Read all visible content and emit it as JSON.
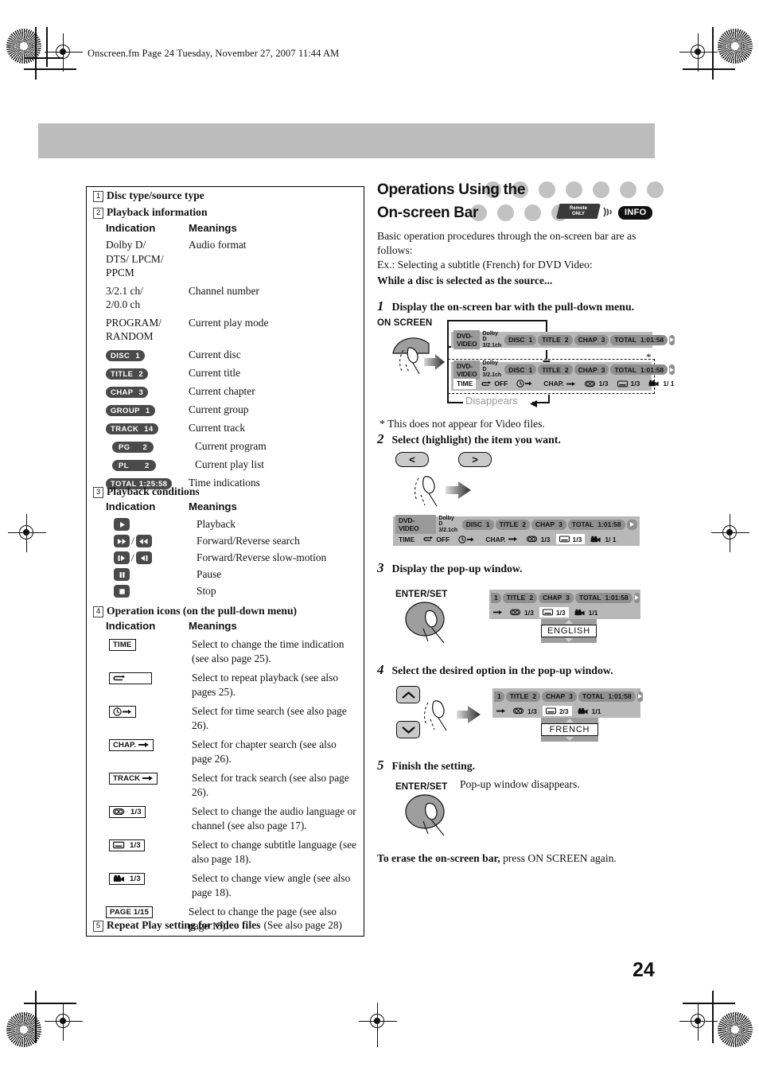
{
  "page": {
    "header_line": "Onscreen.fm  Page 24  Tuesday, November 27, 2007  11:44 AM",
    "page_number": "24"
  },
  "left_panel": {
    "sections": [
      {
        "num": "1",
        "title": "Disc type/source type"
      },
      {
        "num": "2",
        "title": "Playback information"
      },
      {
        "num": "3",
        "title": "Playback conditions"
      },
      {
        "num": "4",
        "title": "Operation icons (on the pull-down menu)"
      },
      {
        "num": "5",
        "title": "Repeat Play setting for video files",
        "suffix": "(See also page 28)"
      }
    ],
    "col_headers": {
      "indication": "Indication",
      "meanings": "Meanings"
    },
    "playback_info_rows": [
      {
        "indication": "Dolby D/\nDTS/ LPCM/\nPPCM",
        "meaning": "Audio format",
        "type": "text"
      },
      {
        "indication": "3/2.1 ch/\n2/0.0 ch",
        "meaning": "Channel number",
        "type": "text"
      },
      {
        "indication": "PROGRAM/\nRANDOM",
        "meaning": "Current play mode",
        "type": "text"
      },
      {
        "indication": "DISC 1",
        "label": "DISC",
        "value": "1",
        "meaning": "Current disc",
        "type": "pill"
      },
      {
        "indication": "TITLE 2",
        "label": "TITLE",
        "value": "2",
        "meaning": "Current title",
        "type": "pill"
      },
      {
        "indication": "CHAP 3",
        "label": "CHAP",
        "value": "3",
        "meaning": "Current chapter",
        "type": "pill"
      },
      {
        "indication": "GROUP 1",
        "label": "GROUP",
        "value": "1",
        "meaning": "Current group",
        "type": "pill"
      },
      {
        "indication": "TRACK 14",
        "label": "TRACK",
        "value": "14",
        "meaning": "Current track",
        "type": "pill"
      },
      {
        "indication": "PG 2",
        "label": "PG",
        "value": "2",
        "meaning": "Current program",
        "type": "pill"
      },
      {
        "indication": "PL 2",
        "label": "PL",
        "value": "2",
        "meaning": "Current play list",
        "type": "pill"
      },
      {
        "indication": "TOTAL 1:25:58",
        "label": "TOTAL",
        "value": "1:25:58",
        "meaning": "Time indications",
        "type": "pill"
      }
    ],
    "playback_condition_rows": [
      {
        "icon": "play-icon",
        "meaning": "Playback"
      },
      {
        "icon": "fast-forward-rewind-icon",
        "meaning": "Forward/Reverse search"
      },
      {
        "icon": "slow-forward-reverse-icon",
        "meaning": "Forward/Reverse slow-motion"
      },
      {
        "icon": "pause-icon",
        "meaning": "Pause"
      },
      {
        "icon": "stop-icon",
        "meaning": "Stop"
      }
    ],
    "operation_icon_rows": [
      {
        "icon": "time-icon",
        "icon_label": "TIME",
        "meaning": "Select to change the time indication (see also page 25)."
      },
      {
        "icon": "repeat-icon",
        "icon_label": "",
        "meaning": "Select to repeat playback (see also pages 25)."
      },
      {
        "icon": "time-search-icon",
        "icon_label": "",
        "meaning": "Select for time search (see also page 26)."
      },
      {
        "icon": "chapter-search-icon",
        "icon_label": "CHAP.",
        "meaning": "Select for chapter search (see also page 26)."
      },
      {
        "icon": "track-search-icon",
        "icon_label": "TRACK",
        "meaning": "Select for track search (see also page 26)."
      },
      {
        "icon": "audio-language-icon",
        "icon_label": "1/3",
        "meaning": "Select to change the audio language or channel (see also page 17)."
      },
      {
        "icon": "subtitle-language-icon",
        "icon_label": "1/3",
        "meaning": "Select to change subtitle language (see also page 18)."
      },
      {
        "icon": "view-angle-icon",
        "icon_label": "1/3",
        "meaning": "Select to change view angle (see also page 18)."
      },
      {
        "icon": "page-icon",
        "icon_label": "PAGE 1/15",
        "meaning": "Select to change the page (see also page 18)."
      }
    ]
  },
  "right_panel": {
    "title_line1": "Operations Using the",
    "title_line2": "On-screen Bar",
    "remote_badge_line1": "Remote",
    "remote_badge_line2": "ONLY",
    "info_badge": "INFO",
    "intro_1": "Basic operation procedures through the on-screen bar are as follows:",
    "intro_2": "Ex.: Selecting a subtitle (French) for DVD Video:",
    "intro_3": "While a disc is selected as the source...",
    "footnote": "* This does not appear for Video files.",
    "closing_bold": "To erase the on-screen bar,",
    "closing_rest": " press ON SCREEN again.",
    "steps": [
      {
        "num": "1",
        "text": "Display the on-screen bar with the pull-down menu.",
        "button_label": "ON SCREEN",
        "caption": "Disappears"
      },
      {
        "num": "2",
        "text": "Select (highlight) the item you want.",
        "button_left": "<",
        "button_right": ">"
      },
      {
        "num": "3",
        "text": "Display the pop-up window.",
        "button_label": "ENTER/SET",
        "popup_value": "ENGLISH"
      },
      {
        "num": "4",
        "text": "Select the desired option in the pop-up window.",
        "popup_value": "FRENCH"
      },
      {
        "num": "5",
        "text": "Finish the setting.",
        "button_label": "ENTER/SET",
        "note": "Pop-up window disappears."
      }
    ],
    "osd_bar": {
      "source": "DVD-VIDEO",
      "format_line1": "Dolby D",
      "format_line2": "3/2.1ch",
      "segments": [
        {
          "label": "DISC",
          "value": "1"
        },
        {
          "label": "TITLE",
          "value": "2"
        },
        {
          "label": "CHAP",
          "value": "3"
        },
        {
          "label": "TOTAL",
          "value": "1:01:58"
        }
      ],
      "pulldown": [
        {
          "icon": "time-icon",
          "label": "TIME"
        },
        {
          "icon": "repeat-icon",
          "label": "OFF"
        },
        {
          "icon": "time-search-icon",
          "label": ""
        },
        {
          "icon": "chapter-search-icon",
          "label": "CHAP."
        },
        {
          "icon": "audio-language-icon",
          "label": "1/3"
        },
        {
          "icon": "subtitle-language-icon",
          "label": "1/3"
        },
        {
          "icon": "view-angle-icon",
          "label": "1/ 1"
        }
      ],
      "subtitle_step4_value": "2/3",
      "angle_step3_value": "1/1"
    }
  },
  "colors": {
    "band_gray": "#bcbcbc",
    "osd_gray": "#b8b8b8",
    "osd_seg": "#8f8f8f",
    "pill_dark": "#4a4a4a",
    "title_circle": "#c2c2c2"
  }
}
